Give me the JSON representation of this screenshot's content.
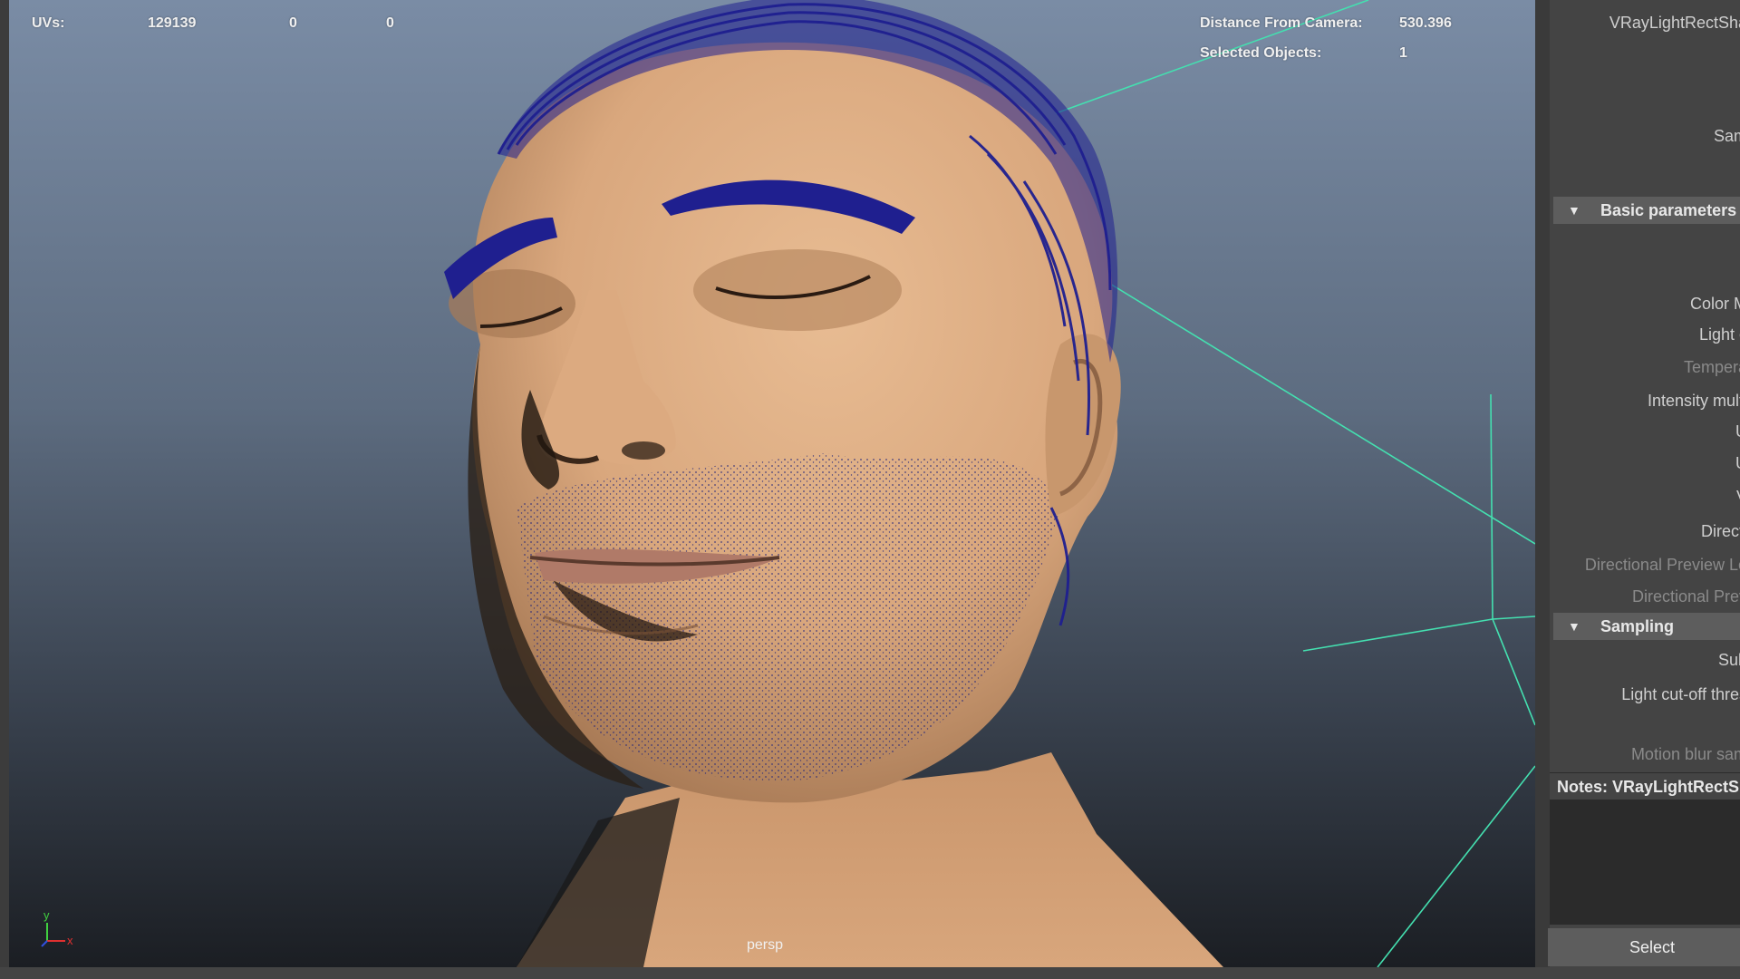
{
  "hud": {
    "uvs_label": "UVs:",
    "uvs_value": "129139",
    "uvs_col2": "0",
    "uvs_col3": "0",
    "distance_label": "Distance From Camera:",
    "distance_value": "530.396",
    "selected_label": "Selected Objects:",
    "selected_value": "1"
  },
  "viewport": {
    "camera_label": "persp",
    "axis_y": "y",
    "axis_x": "x"
  },
  "attribute_editor": {
    "node_name": "VRayLightRectSha",
    "row_sam": "Sam",
    "section_basic": "Basic parameters",
    "row_color_mode": "Color M",
    "row_light_color": "Light c",
    "row_temperature": "Tempera",
    "row_intensity": "Intensity multi",
    "row_u1": "U",
    "row_u2": "U",
    "row_v": "V",
    "row_directional": "Directi",
    "row_dir_preview_len": "Directional Preview Le",
    "row_dir_preview": "Directional Prev",
    "section_sampling": "Sampling",
    "row_subdivs": "Sub",
    "row_cutoff": "Light cut-off thres",
    "row_motion_blur": "Motion blur sam",
    "notes_label": "Notes:  VRayLightRectS",
    "select_button": "Select"
  },
  "colors": {
    "skin": "#d9a77d",
    "hair": "#1f1f8f",
    "light_wire": "#44e0b0"
  },
  "icons": {
    "collapse": "triangle-down-icon"
  }
}
